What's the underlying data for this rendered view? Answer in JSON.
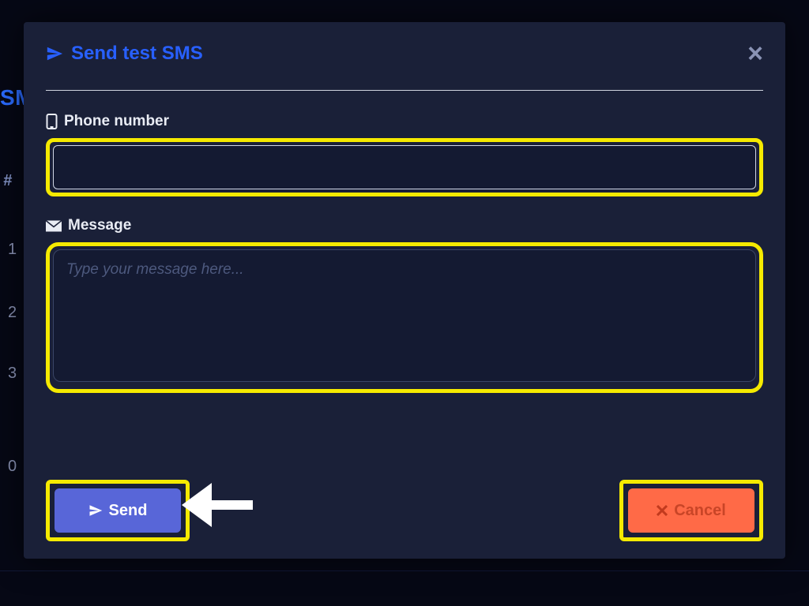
{
  "background": {
    "title_fragment": "SM",
    "hash": "#",
    "rows": [
      "1",
      "2",
      "3",
      "0"
    ]
  },
  "modal": {
    "title": "Send test SMS",
    "close_hint": "×",
    "phone": {
      "label": "Phone number",
      "value": ""
    },
    "message": {
      "label": "Message",
      "placeholder": "Type your message here...",
      "value": ""
    },
    "buttons": {
      "send": "Send",
      "cancel": "Cancel"
    }
  }
}
